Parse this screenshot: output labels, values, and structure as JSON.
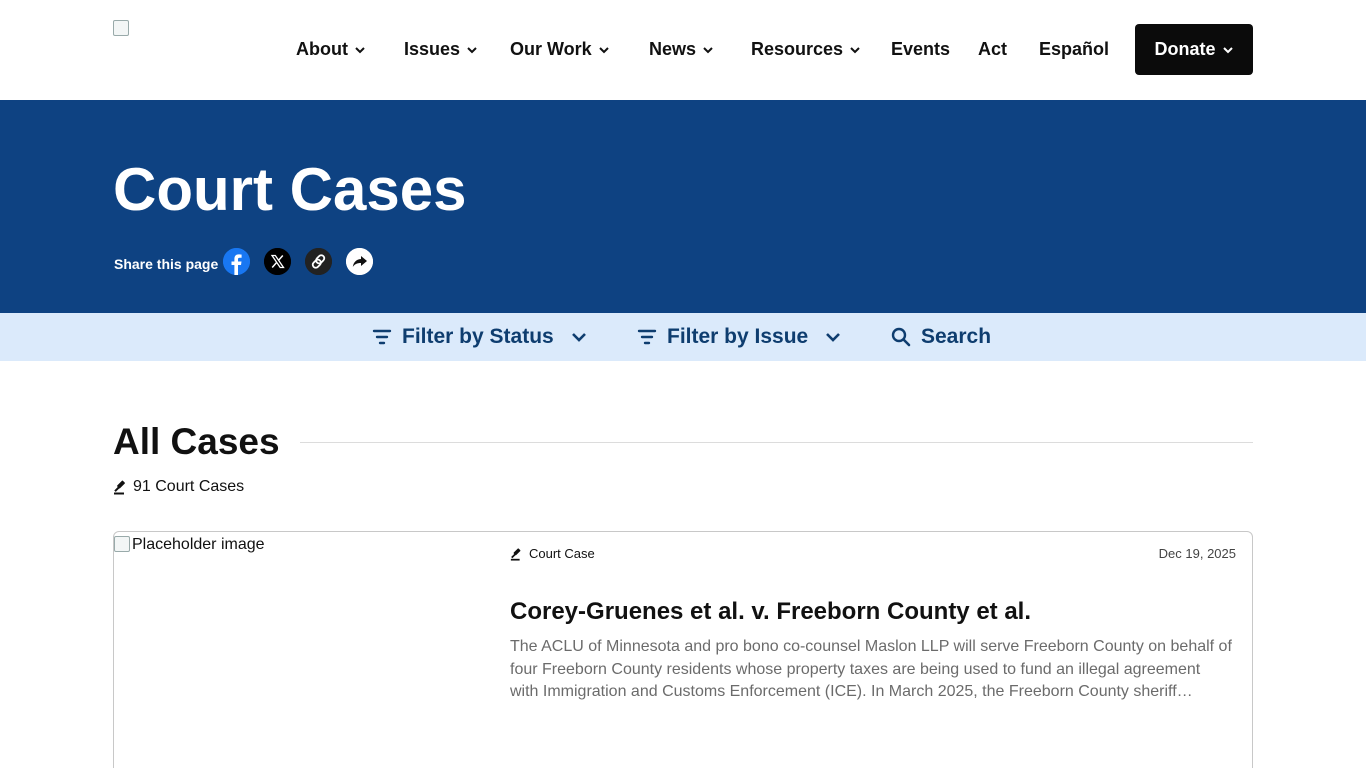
{
  "header": {
    "nav": [
      {
        "label": "About",
        "dropdown": true
      },
      {
        "label": "Issues",
        "dropdown": true
      },
      {
        "label": "Our Work",
        "dropdown": true
      },
      {
        "label": "News",
        "dropdown": true
      },
      {
        "label": "Resources",
        "dropdown": true
      },
      {
        "label": "Events",
        "dropdown": false
      },
      {
        "label": "Act",
        "dropdown": false
      },
      {
        "label": "Español",
        "dropdown": false
      }
    ],
    "donate_label": "Donate"
  },
  "hero": {
    "title": "Court Cases",
    "share_label": "Share this page",
    "share_icons": [
      "facebook-icon",
      "x-icon",
      "link-icon",
      "share-arrow-icon"
    ]
  },
  "filters": {
    "status_label": "Filter by Status",
    "issue_label": "Filter by Issue",
    "search_label": "Search"
  },
  "section": {
    "title": "All Cases",
    "count_text": "91 Court Cases"
  },
  "cases": [
    {
      "image_alt": "Placeholder image",
      "type": "Court Case",
      "date": "Dec 19, 2025",
      "title": "Corey-Gruenes et al. v. Freeborn County et al.",
      "description": "The ACLU of Minnesota and pro bono co-counsel Maslon LLP will serve Freeborn County on behalf of four Freeborn County residents whose property taxes are being used to fund an illegal agreement with Immigration and Customs Enforcement (ICE). In March 2025, the Freeborn County sheriff…"
    }
  ],
  "colors": {
    "hero_bg": "#0e4282",
    "filter_bg": "#dbeafb",
    "filter_text": "#0e3d6f",
    "donate_bg": "#0b0b0b",
    "facebook": "#1877f2"
  }
}
